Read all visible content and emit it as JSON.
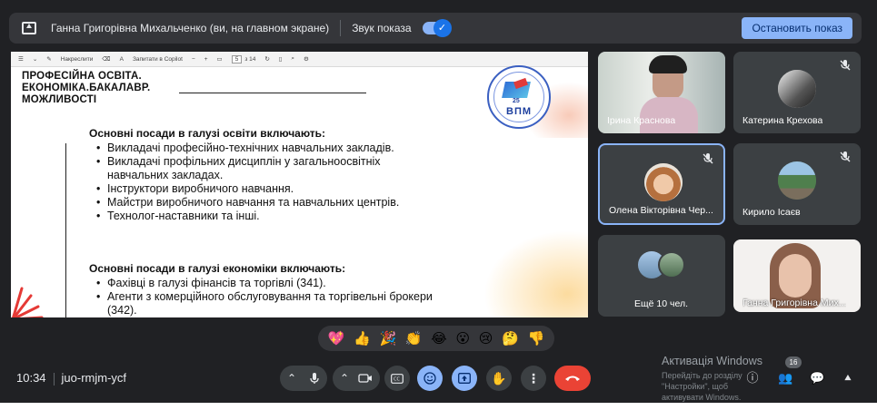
{
  "share_bar": {
    "sharing_text": "Ганна Григорівна Михальченко (ви, на главном экране)",
    "sound_label": "Звук показа",
    "toggle_state": "on",
    "stop_button": "Остановить показ"
  },
  "pdf_toolbar": {
    "draw_label": "Накреслити",
    "copilot_label": "Запитати в Copilot",
    "zoom_minus": "−",
    "zoom_plus": "+",
    "page_current": "5",
    "page_total": "з 14"
  },
  "slide": {
    "header_lines": [
      "ПРОФЕСІЙНА ОСВІТА.",
      "ЕКОНОМІКА.БАКАЛАВР.",
      "МОЖЛИВОСТІ"
    ],
    "logo_year": "25",
    "logo_text": "ВПМ",
    "section1_title": "Основні посади в галузі освіти включають:",
    "section1_items": [
      "Викладачі професійно-технічних навчальних закладів.",
      "Викладачі профільних дисциплін у загальноосвітніх навчальних закладах.",
      "Інструктори виробничого навчання.",
      "Майстри виробничого навчання та навчальних центрів.",
      "Технолог-наставники та інші."
    ],
    "section2_title": "Основні посади в галузі економіки включають:",
    "section2_items": [
      "Фахівці в галузі фінансів та торгівлі (341).",
      "Агенти з комерційного обслуговування та торгівельні брокери (342)."
    ]
  },
  "participants": [
    {
      "name": "Ірина Краснова",
      "muted": false
    },
    {
      "name": "Катерина Крехова",
      "muted": true
    },
    {
      "name": "Олена Вікторівна Чер...",
      "muted": true
    },
    {
      "name": "Кирило Ісаєв",
      "muted": true
    },
    {
      "name": "Ещё 10 чел.",
      "muted": false
    },
    {
      "name": "Ганна Григорівна Мих...",
      "muted": false
    }
  ],
  "reactions": [
    "💖",
    "👍",
    "🎉",
    "👏",
    "😂",
    "😮",
    "😢",
    "🤔",
    "👎"
  ],
  "bottom": {
    "time": "10:34",
    "meeting_code": "juo-rmjm-ycf",
    "activation_title": "Активація Windows",
    "activation_sub": "Перейдіть до розділу \"Настройки\", щоб активувати Windows.",
    "badge_count": "16"
  },
  "colors": {
    "background": "#202124",
    "accent": "#8ab4f8",
    "end_call": "#ea4335"
  }
}
